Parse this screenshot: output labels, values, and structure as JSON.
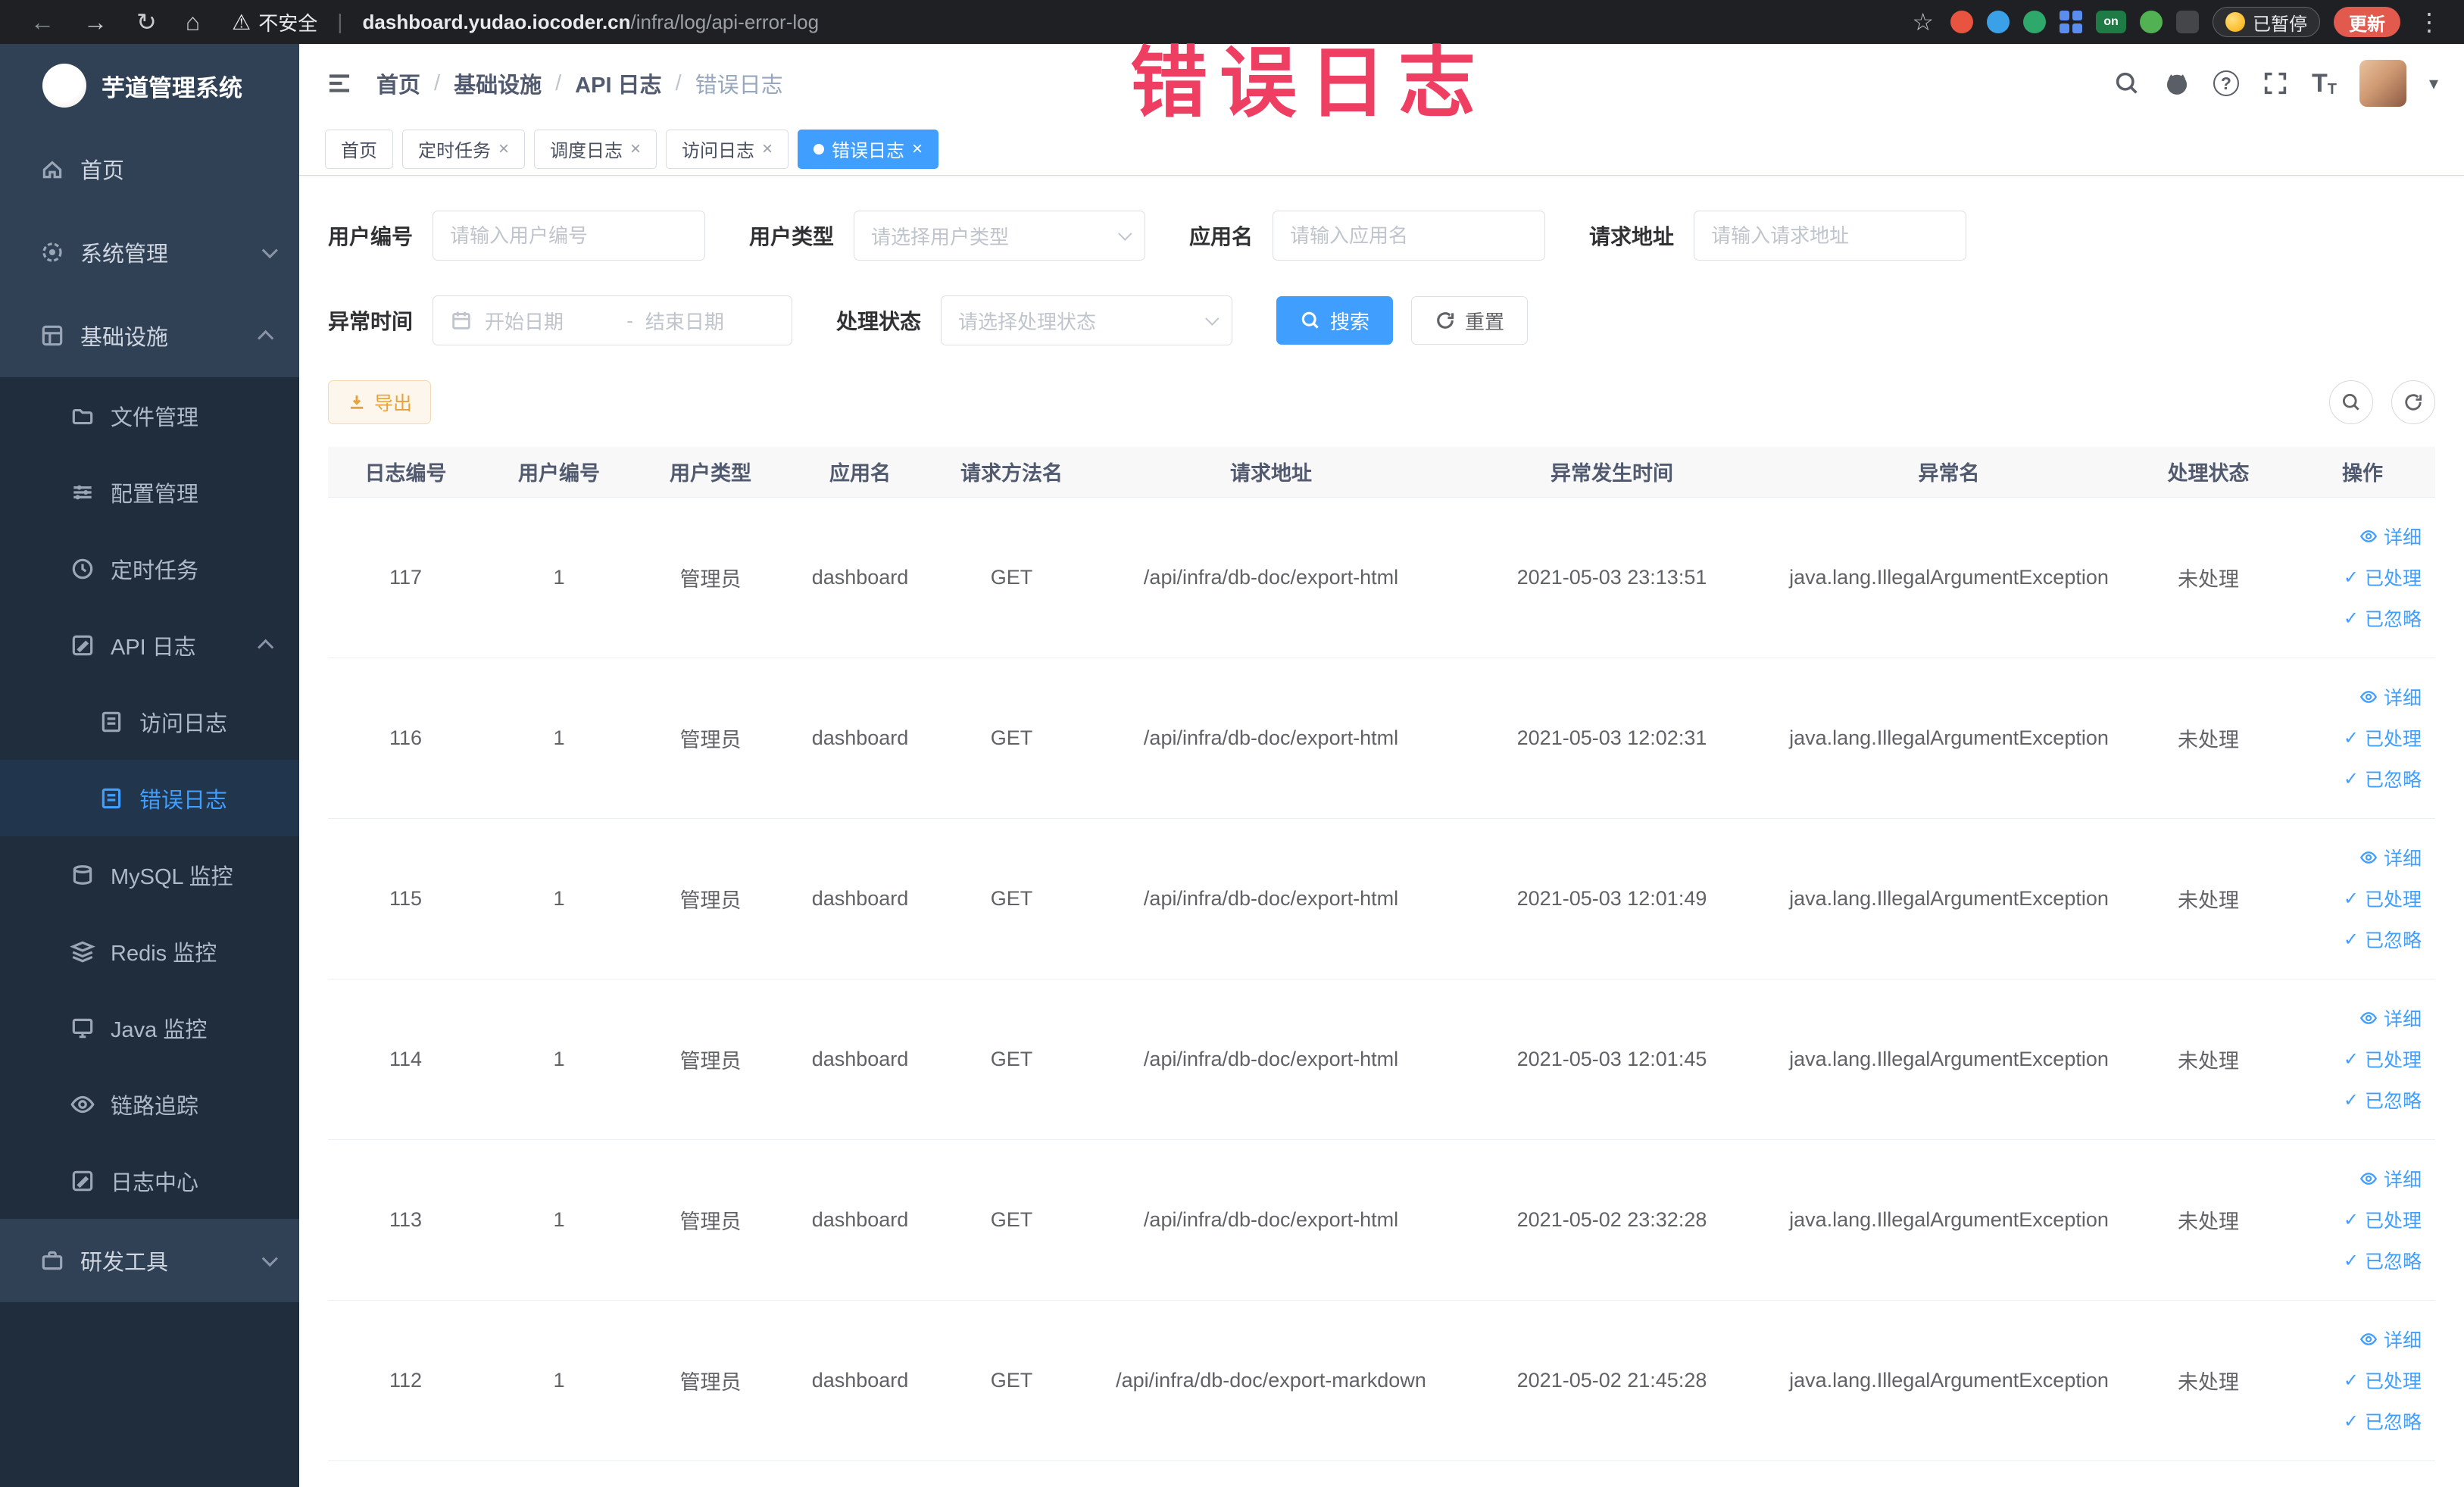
{
  "colors": {
    "accent": "#409eff",
    "warning_text": "#e6a23c",
    "watermark": "#ee3f63",
    "sidebar_bg": "#304156",
    "sidebar_sub_bg": "#1f2d3d",
    "chrome_bg": "#1f2023"
  },
  "ui": {
    "back": "←",
    "forward": "→",
    "reload": "↻",
    "home": "⌂",
    "warning": "⚠",
    "pipe": "|",
    "star": "☆",
    "kebab": "⋮",
    "slash": "/",
    "close": "×",
    "dash": "-",
    "caret": "▾",
    "question": "?",
    "check": "✓",
    "on_badge": "on",
    "font_large": "T",
    "font_small": "T"
  },
  "browser": {
    "security_label": "不安全",
    "url_domain": "dashboard.yudao.iocoder.cn",
    "url_path": "/infra/log/api-error-log",
    "paused_badge": "已暂停",
    "update_button": "更新"
  },
  "watermark_text": "错误日志",
  "sidebar": {
    "logo_title": "芋道管理系统",
    "items": [
      {
        "label": "首页"
      },
      {
        "label": "系统管理"
      },
      {
        "label": "基础设施"
      },
      {
        "label": "文件管理"
      },
      {
        "label": "配置管理"
      },
      {
        "label": "定时任务"
      },
      {
        "label": "API 日志"
      },
      {
        "label": "访问日志"
      },
      {
        "label": "错误日志"
      },
      {
        "label": "MySQL 监控"
      },
      {
        "label": "Redis 监控"
      },
      {
        "label": "Java 监控"
      },
      {
        "label": "链路追踪"
      },
      {
        "label": "日志中心"
      },
      {
        "label": "研发工具"
      }
    ]
  },
  "header": {
    "breadcrumb": [
      "首页",
      "基础设施",
      "API 日志",
      "错误日志"
    ]
  },
  "tabs": [
    {
      "label": "首页"
    },
    {
      "label": "定时任务"
    },
    {
      "label": "调度日志"
    },
    {
      "label": "访问日志"
    },
    {
      "label": "错误日志"
    }
  ],
  "filters": {
    "user_id": {
      "label": "用户编号",
      "placeholder": "请输入用户编号"
    },
    "user_type": {
      "label": "用户类型",
      "placeholder": "请选择用户类型"
    },
    "app_name": {
      "label": "应用名",
      "placeholder": "请输入应用名"
    },
    "request_url": {
      "label": "请求地址",
      "placeholder": "请输入请求地址"
    },
    "exception_time": {
      "label": "异常时间",
      "start_placeholder": "开始日期",
      "separator": "-",
      "end_placeholder": "结束日期"
    },
    "process_status": {
      "label": "处理状态",
      "placeholder": "请选择处理状态"
    },
    "search_button": "搜索",
    "reset_button": "重置"
  },
  "toolbar": {
    "export_button": "导出"
  },
  "table": {
    "columns": [
      "日志编号",
      "用户编号",
      "用户类型",
      "应用名",
      "请求方法名",
      "请求地址",
      "异常发生时间",
      "异常名",
      "处理状态",
      "操作"
    ],
    "actions": [
      "详细",
      "已处理",
      "已忽略"
    ],
    "rows": [
      {
        "id": "117",
        "user_id": "1",
        "user_type": "管理员",
        "app": "dashboard",
        "method": "GET",
        "url": "/api/infra/db-doc/export-html",
        "time": "2021-05-03 23:13:51",
        "exception": "java.lang.IllegalArgumentException",
        "status": "未处理"
      },
      {
        "id": "116",
        "user_id": "1",
        "user_type": "管理员",
        "app": "dashboard",
        "method": "GET",
        "url": "/api/infra/db-doc/export-html",
        "time": "2021-05-03 12:02:31",
        "exception": "java.lang.IllegalArgumentException",
        "status": "未处理"
      },
      {
        "id": "115",
        "user_id": "1",
        "user_type": "管理员",
        "app": "dashboard",
        "method": "GET",
        "url": "/api/infra/db-doc/export-html",
        "time": "2021-05-03 12:01:49",
        "exception": "java.lang.IllegalArgumentException",
        "status": "未处理"
      },
      {
        "id": "114",
        "user_id": "1",
        "user_type": "管理员",
        "app": "dashboard",
        "method": "GET",
        "url": "/api/infra/db-doc/export-html",
        "time": "2021-05-03 12:01:45",
        "exception": "java.lang.IllegalArgumentException",
        "status": "未处理"
      },
      {
        "id": "113",
        "user_id": "1",
        "user_type": "管理员",
        "app": "dashboard",
        "method": "GET",
        "url": "/api/infra/db-doc/export-html",
        "time": "2021-05-02 23:32:28",
        "exception": "java.lang.IllegalArgumentException",
        "status": "未处理"
      },
      {
        "id": "112",
        "user_id": "1",
        "user_type": "管理员",
        "app": "dashboard",
        "method": "GET",
        "url": "/api/infra/db-doc/export-markdown",
        "time": "2021-05-02 21:45:28",
        "exception": "java.lang.IllegalArgumentException",
        "status": "未处理"
      }
    ]
  }
}
